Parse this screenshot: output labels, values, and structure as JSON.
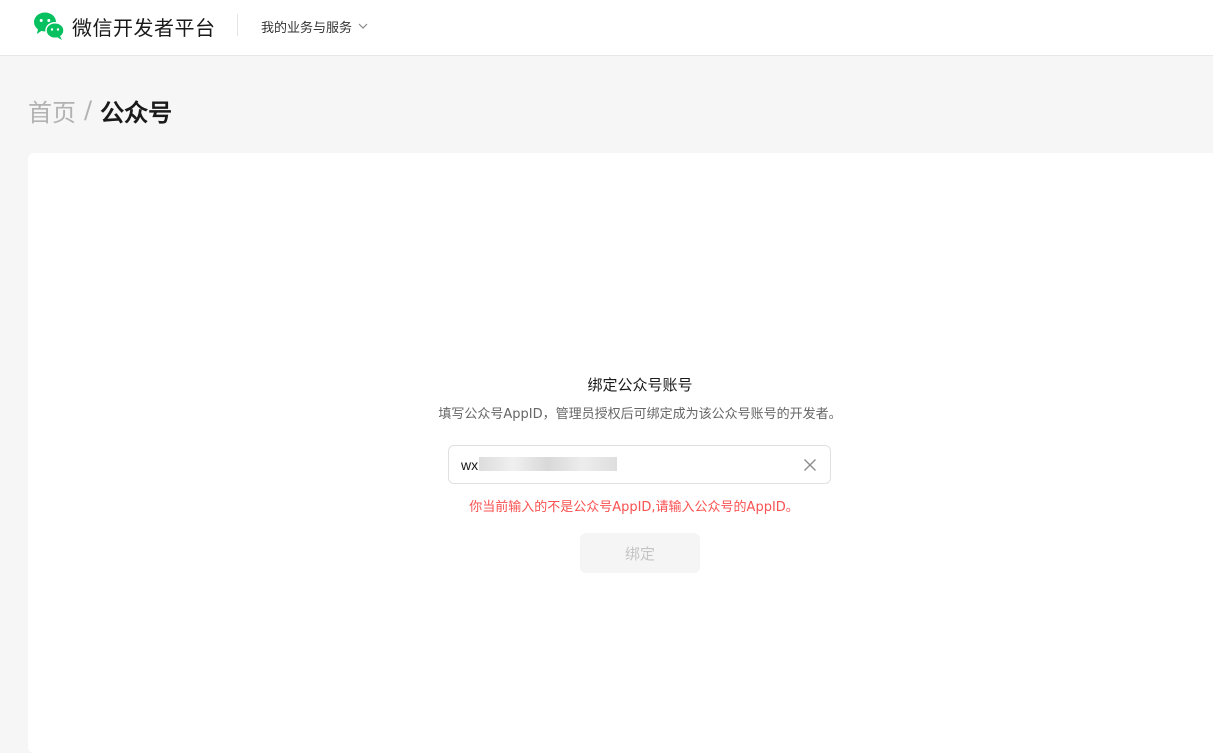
{
  "header": {
    "brand_title": "微信开发者平台",
    "logo_icon": "wechat-logo-icon",
    "biz_menu_label": "我的业务与服务",
    "biz_menu_icon": "chevron-down-icon"
  },
  "breadcrumb": {
    "home": "首页",
    "separator": "/",
    "current": "公众号"
  },
  "bind_form": {
    "title": "绑定公众号账号",
    "description": "填写公众号AppID，管理员授权后可绑定成为该公众号账号的开发者。",
    "appid_value": "wx",
    "clear_icon": "close-icon",
    "error_message": "你当前输入的不是公众号AppID,请输入公众号的AppID。",
    "submit_label": "绑定",
    "submit_enabled": false
  },
  "colors": {
    "brand_green": "#07c160",
    "error_red": "#fa5151",
    "page_bg": "#f6f6f6"
  }
}
